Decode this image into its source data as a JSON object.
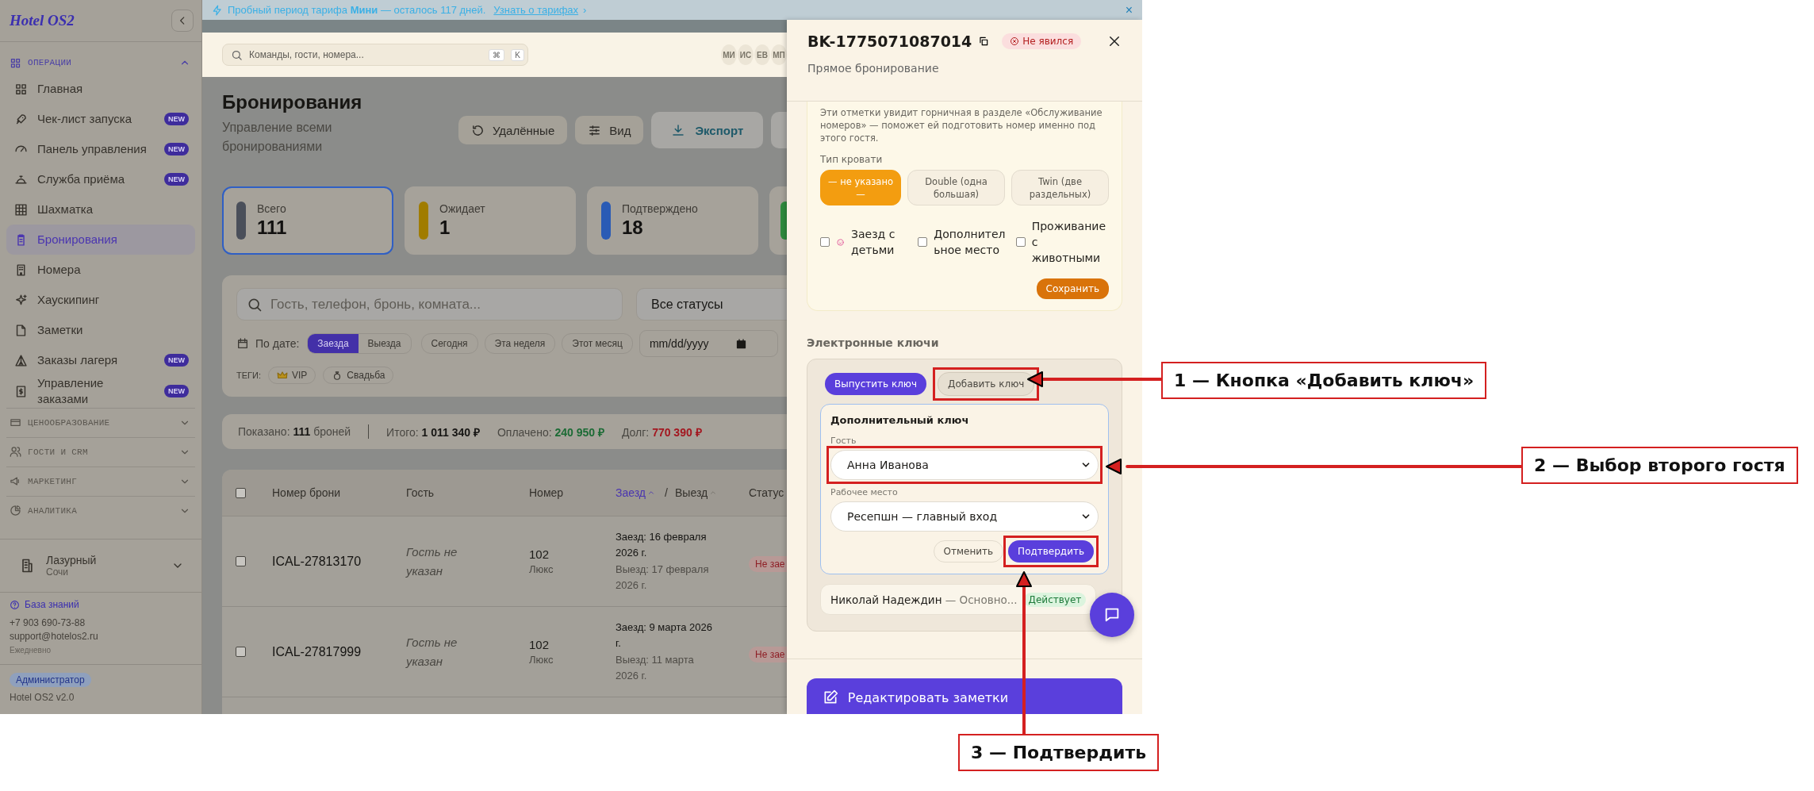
{
  "banner": {
    "text": "Пробный период тарифа **Мини** — осталось 117 дней.",
    "link": "Узнать о тарифах",
    "link_arrow": "›",
    "close": "×"
  },
  "sidebar": {
    "logo": "Hotel OS2",
    "sections": [
      {
        "title": "ОПЕРАЦИИ",
        "expanded": true,
        "items": [
          {
            "label": "Главная",
            "selected": false
          },
          {
            "label": "Чек-лист запуска",
            "badge": "NEW",
            "selected": false
          },
          {
            "label": "Панель управления",
            "badge": "NEW",
            "selected": false
          },
          {
            "label": "Служба приёма",
            "badge": "NEW",
            "selected": false
          },
          {
            "label": "Шахматка",
            "selected": false
          },
          {
            "label": "Бронирования",
            "selected": true
          },
          {
            "label": "Номера",
            "selected": false
          },
          {
            "label": "Хаускипинг",
            "selected": false
          },
          {
            "label": "Заметки",
            "selected": false
          },
          {
            "label": "Заказы лагеря",
            "badge": "NEW",
            "selected": false
          },
          {
            "label": "Управление заказами",
            "badge": "NEW",
            "selected": false
          }
        ]
      },
      {
        "title": "ЦЕНООБРАЗОВАНИЕ",
        "expanded": false
      },
      {
        "title": "ГОСТИ И CRM",
        "expanded": false
      },
      {
        "title": "МАРКЕТИНГ",
        "expanded": false
      },
      {
        "title": "АНАЛИТИКА",
        "expanded": false
      }
    ],
    "property": {
      "name": "Лазурный",
      "city": "Сочи"
    },
    "support": {
      "link": "База знаний",
      "phone": "+7 903 690-73-88",
      "email": "support@hotelos2.ru",
      "hours": "Ежедневно"
    },
    "role": "Администратор",
    "version": "Hotel OS2 v2.0"
  },
  "topbar": {
    "search_placeholder": "Команды, гости, номера...",
    "keys": [
      "⌘",
      "K"
    ],
    "avatars": [
      "МИ",
      "ИС",
      "ЕВ",
      "МП"
    ]
  },
  "page": {
    "title": "Бронирования",
    "subtitle": "Управление всеми бронированиями",
    "buttons": [
      {
        "kind": "plain",
        "label": "Удалённые"
      },
      {
        "kind": "plain",
        "label": "Вид"
      },
      {
        "kind": "export",
        "label": "Экспорт"
      },
      {
        "kind": "cut"
      }
    ]
  },
  "stats": [
    {
      "label": "Всего",
      "value": "111",
      "color": "#4a4f5a",
      "selected": true
    },
    {
      "label": "Ожидает",
      "value": "1",
      "color": "#a07c00",
      "selected": false
    },
    {
      "label": "Подтверждено",
      "value": "18",
      "color": "#2a5bb5",
      "selected": false
    },
    {
      "color": "#2e8b3e",
      "selected": false
    }
  ],
  "filters": {
    "search_placeholder": "Гость, телефон, бронь, комната...",
    "status": "Все статусы",
    "date_label": "По дате:",
    "date_modes": [
      {
        "label": "Заезда",
        "selected": true
      },
      {
        "label": "Выезда",
        "selected": false
      }
    ],
    "quick": [
      "Сегодня",
      "Эта неделя",
      "Этот месяц"
    ],
    "date_placeholder": "mm/dd/yyyy",
    "tags_label": "ТЕГИ:",
    "tags": [
      "VIP",
      "Свадьба"
    ]
  },
  "summary": [
    {
      "label": "Показано:",
      "value": "111",
      "suffix": "броней",
      "color": "#161513"
    },
    {
      "label": "Итого:",
      "value": "1 011 340 ₽",
      "color": "#161513"
    },
    {
      "label": "Оплачено:",
      "value": "240 950 ₽",
      "color": "#1c6b35"
    },
    {
      "label": "Долг:",
      "value": "770 390 ₽",
      "color": "#a3161f"
    }
  ],
  "table": {
    "select_all": false,
    "sort_separator": "/",
    "columns": [
      {
        "label": "Номер брони"
      },
      {
        "label": "Гость"
      },
      {
        "label": "Номер"
      },
      {
        "label": "Заезд",
        "sorted": true
      },
      {
        "label": "Выезд",
        "sorted": false
      },
      {
        "label": "Статус"
      }
    ],
    "rows": [
      {
        "checked": false,
        "booking": "ICAL-27813170",
        "guest": "Гость не указан",
        "room": "102",
        "room_type": "Люкс",
        "checkin": "Заезд: 16 февраля 2026 г.",
        "checkout": "Выезд: 17 февраля 2026 г.",
        "status": "Не зае"
      },
      {
        "checked": false,
        "booking": "ICAL-27817999",
        "guest": "Гость не указан",
        "room": "102",
        "room_type": "Люкс",
        "checkin": "Заезд: 9 марта 2026 г.",
        "checkout": "Выезд: 11 марта 2026 г.",
        "status": "Не зае"
      }
    ]
  },
  "drawer": {
    "title": "BK-1775071087014",
    "status": "Не явился",
    "subtitle": "Прямое бронирование",
    "prefs": {
      "note": "Эти отметки увидит горничная в разделе «Обслуживание номеров» — поможет ей подготовить номер именно под этого гостя.",
      "bed_label": "Тип кровати",
      "bed_types": [
        {
          "label": "— не указано —",
          "selected": true
        },
        {
          "label": "Double (одна большая)",
          "selected": false
        },
        {
          "label": "Twin (две раздельных)",
          "selected": false
        }
      ],
      "options": [
        {
          "label": "Заезд с детьми",
          "checked": false
        },
        {
          "label": "Дополнительное место",
          "checked": false
        },
        {
          "label": "Проживание с животными",
          "checked": false
        }
      ],
      "save": "Сохранить"
    },
    "keys": {
      "heading": "Электронные ключи",
      "actions": [
        {
          "kind": "primary",
          "label": "Выпустить ключ",
          "highlighted": false
        },
        {
          "kind": "secondary",
          "label": "Добавить ключ",
          "highlighted": true
        }
      ],
      "form": {
        "title": "Дополнительный ключ",
        "fields": [
          {
            "label": "Гость",
            "value": "Анна Иванова",
            "highlighted": true
          },
          {
            "label": "Рабочее место",
            "value": "Ресепшн — главный вход",
            "highlighted": false
          }
        ],
        "cancel": "Отменить",
        "confirm": "Подтвердить",
        "confirm_highlighted": true
      },
      "list": [
        {
          "guest": "Николай Надеждин",
          "detail": "— Основно...",
          "status": "Действует"
        }
      ]
    },
    "footer_button": "Редактировать заметки"
  },
  "annotations": [
    {
      "text": "1 — Кнопка «Добавить ключ»"
    },
    {
      "text": "2 — Выбор второго гостя"
    },
    {
      "text": "3 — Подтвердить"
    }
  ]
}
